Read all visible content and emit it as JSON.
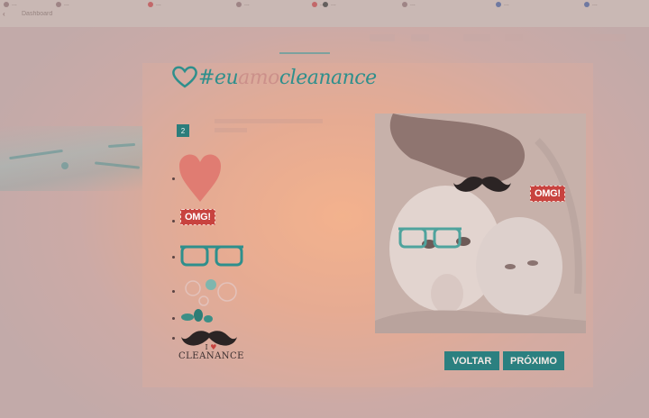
{
  "browser": {
    "tab_title": "Dashboard",
    "bookmarks": [
      "...",
      "...",
      "...",
      "...",
      "...",
      "...",
      "...",
      "...",
      "..."
    ]
  },
  "app": {
    "logo_prefix": "#eu",
    "logo_middle": "amo",
    "logo_suffix": "cleanance",
    "step_number": "2"
  },
  "stickers": {
    "omg_label": "OMG!",
    "footer_line1": "I",
    "footer_line2": "CLEANANCE"
  },
  "photo": {
    "omg_label": "OMG!"
  },
  "buttons": {
    "back_label": "VOLTAR",
    "next_label": "PRÓXIMO"
  },
  "colors": {
    "accent": "#2b8080",
    "logo": "#2e8f8c",
    "heart": "#e07c72",
    "omg": "#c8433f"
  }
}
